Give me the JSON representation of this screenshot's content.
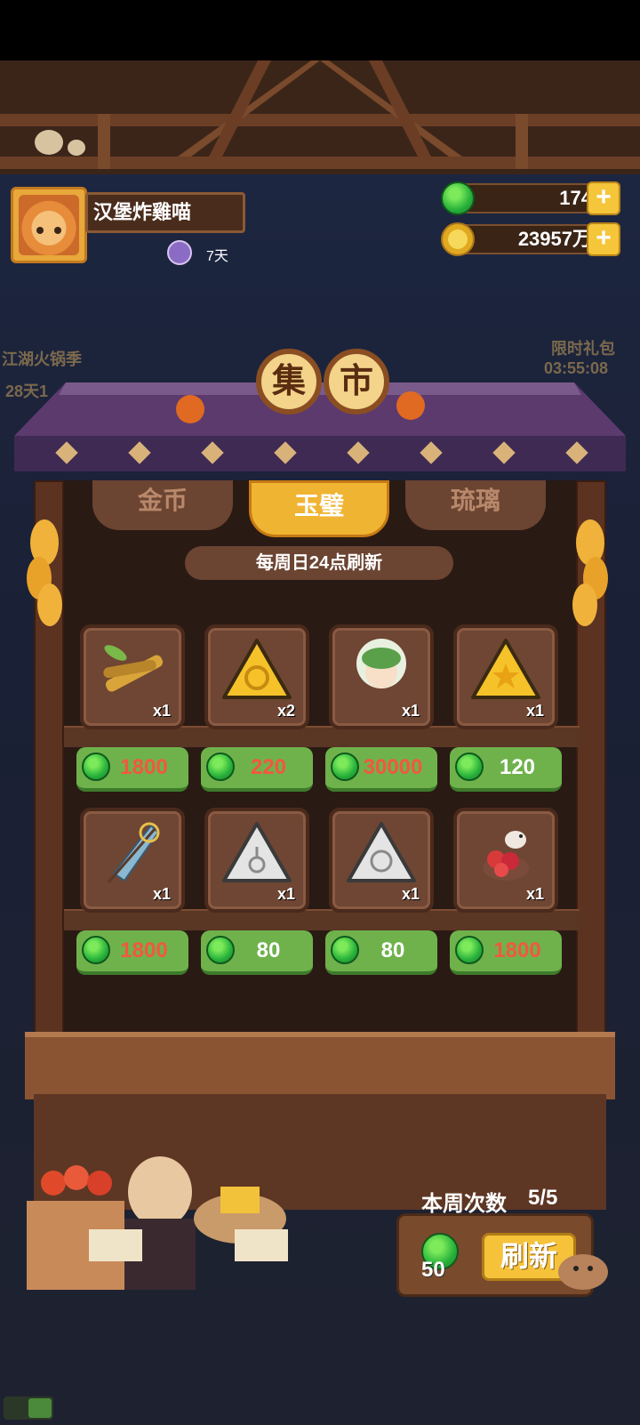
{
  "player": {
    "name": "汉堡炸雞喵",
    "days": "7天"
  },
  "currencies": {
    "jade": "174",
    "coins": "23957万"
  },
  "side_events": {
    "left_title": "江湖火锅季",
    "left_timer": "28天1",
    "right_title": "限时礼包",
    "right_timer": "03:55:08"
  },
  "shop": {
    "sign": [
      "集",
      "市"
    ],
    "tabs": [
      "金币",
      "玉璧",
      "琉璃"
    ],
    "active_tab": "玉璧",
    "refresh_note": "每周日24点刷新",
    "items": [
      {
        "icon": "bamboo-icon",
        "qty": "x1",
        "price": "1800",
        "affordable": false
      },
      {
        "icon": "gold-spiral-rice-dumpling-icon",
        "qty": "x2",
        "price": "220",
        "affordable": false
      },
      {
        "icon": "green-haired-character-icon",
        "qty": "x1",
        "price": "30000",
        "affordable": false
      },
      {
        "icon": "gold-star-rice-dumpling-icon",
        "qty": "x1",
        "price": "120",
        "affordable": true
      },
      {
        "icon": "paper-umbrella-icon",
        "qty": "x1",
        "price": "1800",
        "affordable": false
      },
      {
        "icon": "silver-flower-rice-dumpling-icon",
        "qty": "x1",
        "price": "80",
        "affordable": true
      },
      {
        "icon": "silver-spiral-rice-dumpling-icon",
        "qty": "x1",
        "price": "80",
        "affordable": true
      },
      {
        "icon": "bird-flower-pot-icon",
        "qty": "x1",
        "price": "1800",
        "affordable": false
      }
    ]
  },
  "weekly": {
    "label": "本周次数",
    "count": "5/5",
    "refresh_cost": "50",
    "refresh_label": "刷新"
  },
  "colors": {
    "price_unaffordable": "#f2583e",
    "price_bg": "#6fb24c",
    "accent": "#f5c23a"
  }
}
